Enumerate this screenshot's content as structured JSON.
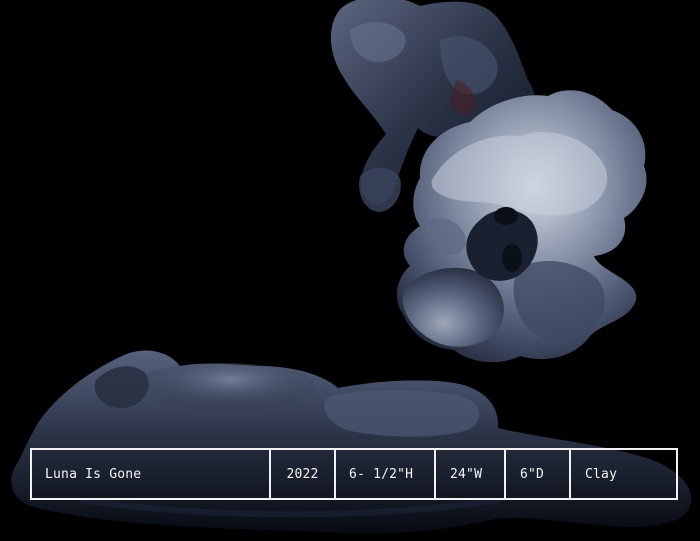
{
  "artwork": {
    "title": "Luna Is Gone",
    "year": "2022",
    "height": "6- 1/2\"H",
    "width": "24\"W",
    "depth": "6\"D",
    "material": "Clay"
  },
  "colors": {
    "background": "#000000",
    "caption_border": "#f2f2f2",
    "caption_text": "#f4f4f4",
    "sculpture_tone": "#3c4a66"
  }
}
